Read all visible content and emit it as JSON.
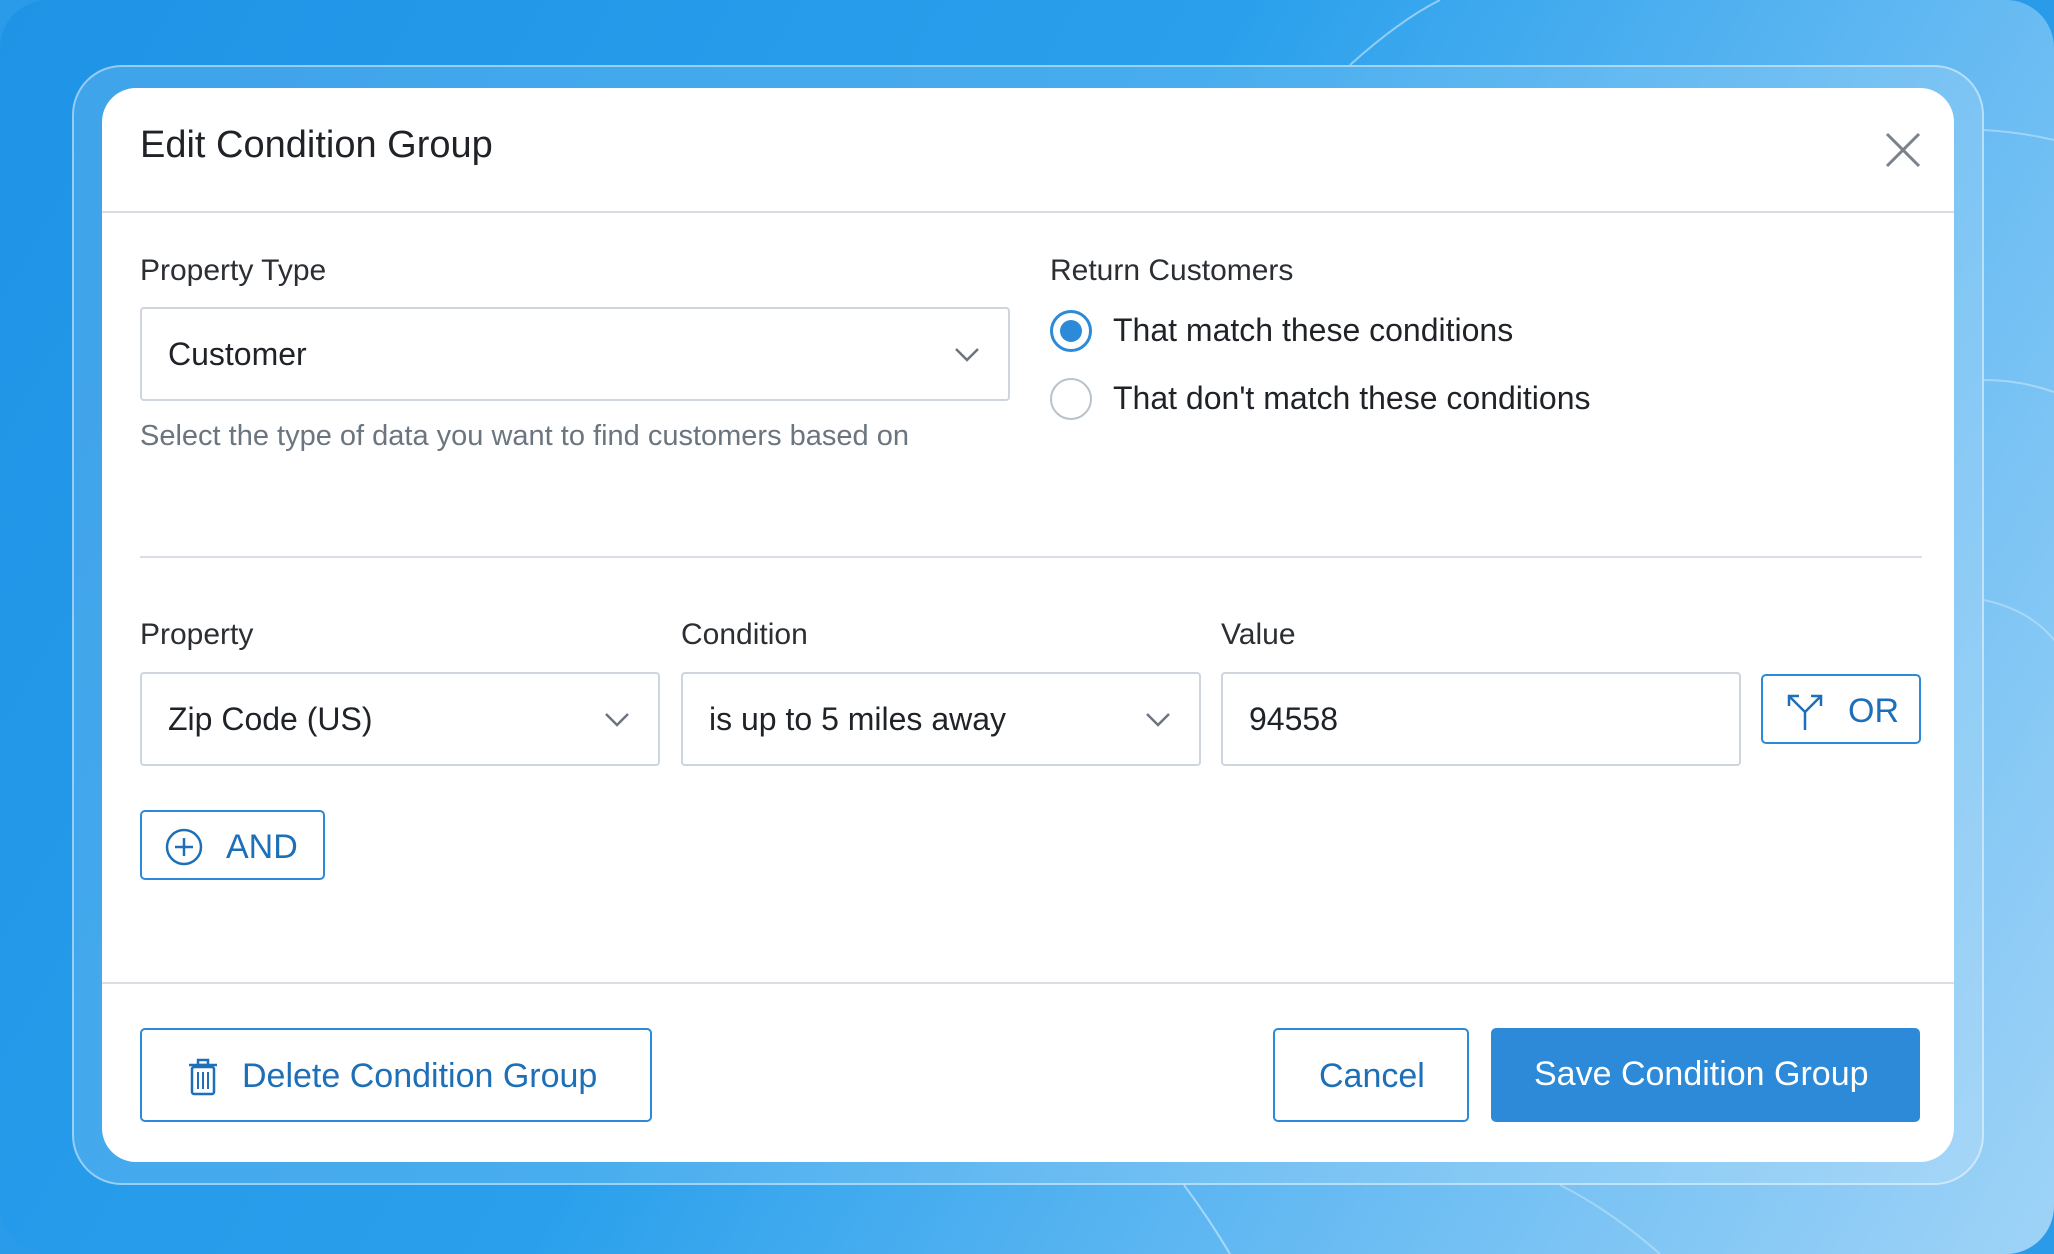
{
  "dialog": {
    "title": "Edit Condition Group",
    "close_icon": "close-icon"
  },
  "property_type": {
    "label": "Property Type",
    "value": "Customer",
    "hint": "Select the type of data you want to find customers based on"
  },
  "return_customers": {
    "label": "Return Customers",
    "options": [
      {
        "label": "That match these conditions",
        "selected": true
      },
      {
        "label": "That don't match these conditions",
        "selected": false
      }
    ]
  },
  "condition_row": {
    "property_label": "Property",
    "property_value": "Zip Code (US)",
    "condition_label": "Condition",
    "condition_value": "is up to 5 miles away",
    "value_label": "Value",
    "value_value": "94558",
    "or_button": "OR",
    "or_icon": "branch-icon"
  },
  "and_button": {
    "label": "AND",
    "icon": "plus-circle-icon"
  },
  "footer": {
    "delete_label": "Delete Condition Group",
    "delete_icon": "trash-icon",
    "cancel_label": "Cancel",
    "save_label": "Save Condition Group"
  },
  "colors": {
    "accent": "#2d8ad8",
    "accent_text": "#1d6fb8",
    "background": "#2a9be8"
  }
}
